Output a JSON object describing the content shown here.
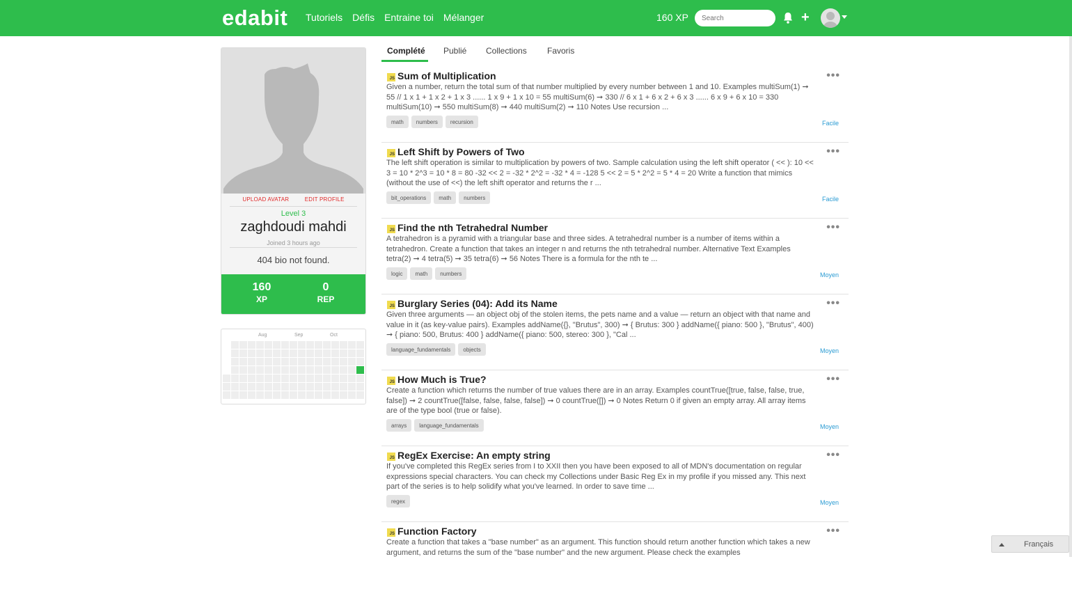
{
  "nav": {
    "logo": "edabit",
    "links": [
      "Tutoriels",
      "Défis",
      "Entraine toi",
      "Mélanger"
    ],
    "xp": "160 XP",
    "search_placeholder": "Search"
  },
  "profile": {
    "upload_avatar": "UPLOAD AVATAR",
    "edit_profile": "EDIT PROFILE",
    "level": "Level 3",
    "username": "zaghdoudi mahdi",
    "joined": "Joined 3 hours ago",
    "bio": "404 bio not found.",
    "stats": [
      {
        "value": "160",
        "label": "XP"
      },
      {
        "value": "0",
        "label": "REP"
      }
    ]
  },
  "activity": {
    "months": [
      "Aug",
      "Sep",
      "Oct"
    ]
  },
  "tabs": [
    "Complété",
    "Publié",
    "Collections",
    "Favoris"
  ],
  "challenges": [
    {
      "title": "Sum of Multiplication",
      "description": "Given a number, return the total sum of that number multiplied by every number between 1 and 10. Examples multiSum(1) ➞ 55 // 1 x 1 + 1 x 2 + 1 x 3 ...... 1 x 9 + 1 x 10 = 55 multiSum(6) ➞ 330 // 6 x 1 + 6 x 2 + 6 x 3 ...... 6 x 9 + 6 x 10 = 330 multiSum(10) ➞ 550 multiSum(8) ➞ 440 multiSum(2) ➞ 110 Notes Use recursion ...",
      "tags": [
        "math",
        "numbers",
        "recursion"
      ],
      "difficulty": "Facile"
    },
    {
      "title": "Left Shift by Powers of Two",
      "description": "The left shift operation is similar to multiplication by powers of two. Sample calculation using the left shift operator ( << ): 10 << 3 = 10 * 2^3 = 10 * 8 = 80 -32 << 2 = -32 * 2^2 = -32 * 4 = -128 5 << 2 = 5 * 2^2 = 5 * 4 = 20 Write a function that mimics (without the use of <<) the left shift operator and returns the r ...",
      "tags": [
        "bit_operations",
        "math",
        "numbers"
      ],
      "difficulty": "Facile"
    },
    {
      "title": "Find the nth Tetrahedral Number",
      "description": "A tetrahedron is a pyramid with a triangular base and three sides. A tetrahedral number is a number of items within a tetrahedron. Create a function that takes an integer n and returns the nth tetrahedral number. Alternative Text Examples tetra(2) ➞ 4 tetra(5) ➞ 35 tetra(6) ➞ 56 Notes There is a formula for the nth te ...",
      "tags": [
        "logic",
        "math",
        "numbers"
      ],
      "difficulty": "Moyen"
    },
    {
      "title": "Burglary Series (04): Add its Name",
      "description": "Given three arguments — an object obj of the stolen items, the pets name and a value — return an object with that name and value in it (as key-value pairs). Examples addName({}, \"Brutus\", 300) ➞ { Brutus: 300 } addName({ piano: 500 }, \"Brutus\", 400) ➞ { piano: 500, Brutus: 400 } addName({ piano: 500, stereo: 300 }, \"Cal ...",
      "tags": [
        "language_fundamentals",
        "objects"
      ],
      "difficulty": "Moyen"
    },
    {
      "title": "How Much is True?",
      "description": "Create a function which returns the number of true values there are in an array. Examples countTrue([true, false, false, true, false]) ➞ 2 countTrue([false, false, false, false]) ➞ 0 countTrue([]) ➞ 0 Notes Return 0 if given an empty array. All array items are of the type bool (true or false).",
      "tags": [
        "arrays",
        "language_fundamentals"
      ],
      "difficulty": "Moyen"
    },
    {
      "title": "RegEx Exercise: An empty string",
      "description": "If you've completed this RegEx series from I to XXII then you have been exposed to all of MDN's documentation on regular expressions special characters. You can check my Collections under Basic Reg Ex in my profile if you missed any. This next part of the series is to help solidify what you've learned. In order to save time ...",
      "tags": [
        "regex"
      ],
      "difficulty": "Moyen"
    },
    {
      "title": "Function Factory",
      "description": "Create a function that takes a \"base number\" as an argument. This function should return another function which takes a new argument, and returns the sum of the \"base number\" and the new argument. Please check the examples",
      "tags": [],
      "difficulty": ""
    }
  ],
  "language": "Français",
  "colors": {
    "brand": "#2ebd4c",
    "difficulty": "#2a9bd3",
    "link_red": "#e02828",
    "js_badge": "#f0db4f"
  }
}
